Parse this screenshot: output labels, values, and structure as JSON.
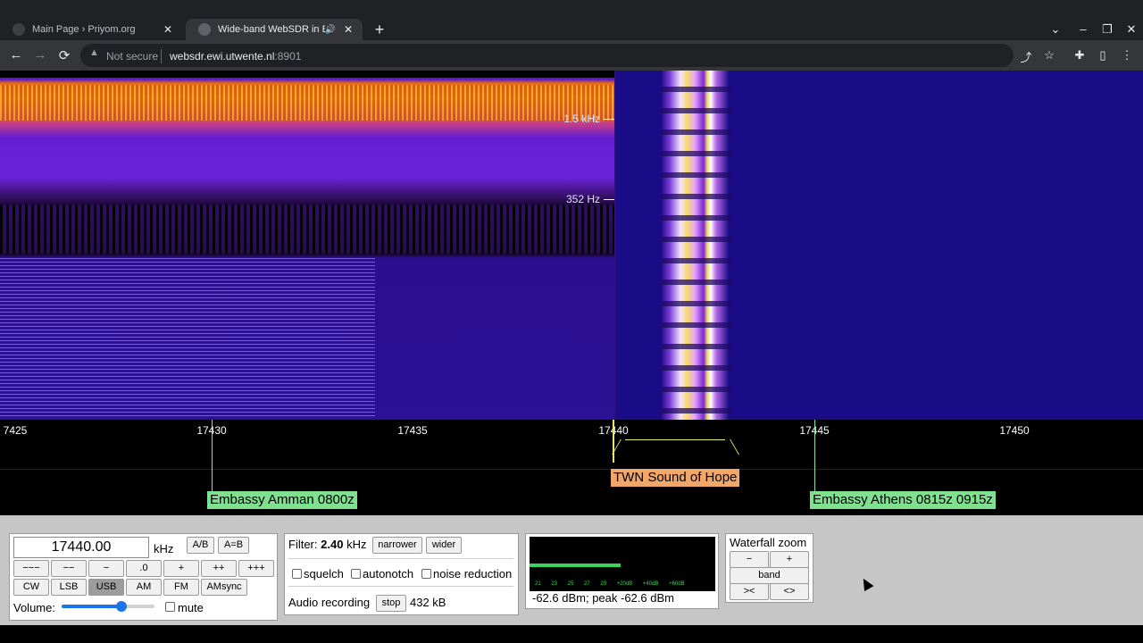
{
  "browser": {
    "tabs": [
      {
        "title": "Main Page › Priyom.org",
        "close": "✕"
      },
      {
        "title": "Wide-band WebSDR in Enschede",
        "close": "✕",
        "audio": "🔊"
      }
    ],
    "new_tab": "+",
    "window_controls": [
      "⌄",
      "–",
      "❐",
      "✕"
    ],
    "security_label": "Not secure",
    "url_host": "websdr.ewi.utwente.nl",
    "url_port": ":8901"
  },
  "waterfall": {
    "markers": [
      "1.5 kHz",
      "352 Hz"
    ]
  },
  "scale": {
    "ticks": [
      "7425",
      "17430",
      "17435",
      "17440",
      "17445",
      "17450"
    ],
    "stations": [
      {
        "label": "Embassy Amman 0800z",
        "tuned": false
      },
      {
        "label": "TWN Sound of Hope",
        "tuned": true
      },
      {
        "label": "Embassy Athens 0815z 0915z",
        "tuned": false
      }
    ]
  },
  "tuning": {
    "frequency": "17440.00",
    "unit": "kHz",
    "ab": "A/B",
    "a_eq_b": "A=B",
    "steps": [
      "−−−",
      "−−",
      "−",
      ".0",
      "+",
      "++",
      "+++"
    ],
    "modes": [
      "CW",
      "LSB",
      "USB",
      "AM",
      "FM",
      "AMsync"
    ],
    "active_mode": "USB",
    "volume_label": "Volume:",
    "volume_level": 0.64,
    "mute_label": "mute"
  },
  "filter": {
    "label": "Filter:",
    "bandwidth": "2.40",
    "unit": "kHz",
    "narrower": "narrower",
    "wider": "wider",
    "options": [
      "squelch",
      "autonotch",
      "noise reduction"
    ],
    "recording_label": "Audio recording",
    "stop": "stop",
    "size": "432 kB"
  },
  "smeter": {
    "ticks": "21 23 25 27 29 +20dB +40dB +60dB",
    "level_fraction": 0.49,
    "readout": "-62.6 dBm; peak  -62.6 dBm"
  },
  "zoom": {
    "title": "Waterfall zoom",
    "minus": "−",
    "plus": "+",
    "band": "band",
    "in": "><",
    "out": "<>"
  }
}
